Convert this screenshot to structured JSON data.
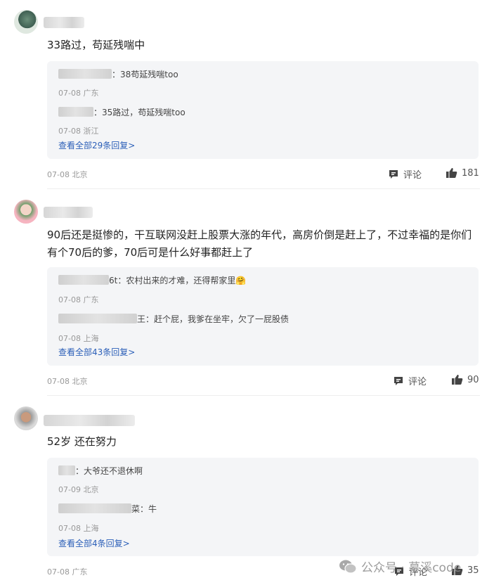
{
  "comments": [
    {
      "text": "33路过，苟延残喘中",
      "replies": [
        {
          "name_suffix": "：38苟延残喘too",
          "meta": "07-08 广东"
        },
        {
          "name_suffix": "：35路过，苟延残喘too",
          "meta": "07-08 浙江"
        }
      ],
      "see_all": "查看全部29条回复>",
      "meta": "07-08 北京",
      "comment_label": "评论",
      "likes": "181"
    },
    {
      "text": "90后还是挺惨的，干互联网没赶上股票大涨的年代，高房价倒是赶上了，不过幸福的是你们有个70后的爹，70后可是什么好事都赶上了",
      "replies": [
        {
          "name_suffix": "6t：农村出来的才难，还得帮家里🤗",
          "meta": "07-08 广东"
        },
        {
          "name_suffix": "王：赶个屁，我爹在坐牢，欠了一屁股债",
          "meta": "07-08 上海"
        }
      ],
      "see_all": "查看全部43条回复>",
      "meta": "07-08 北京",
      "comment_label": "评论",
      "likes": "90"
    },
    {
      "text": "52岁 还在努力",
      "replies": [
        {
          "name_suffix": "：大爷还不退休啊",
          "meta": "07-09 北京"
        },
        {
          "name_suffix": "菜：牛",
          "meta": "07-08 上海"
        }
      ],
      "see_all": "查看全部4条回复>",
      "meta": "07-08 广东",
      "comment_label": "评论",
      "likes": "35"
    }
  ],
  "watermark": "公众号 · 慕溪code",
  "icons": {
    "comment": "comment-icon",
    "like": "thumbs-up-icon",
    "wechat": "wechat-icon"
  }
}
